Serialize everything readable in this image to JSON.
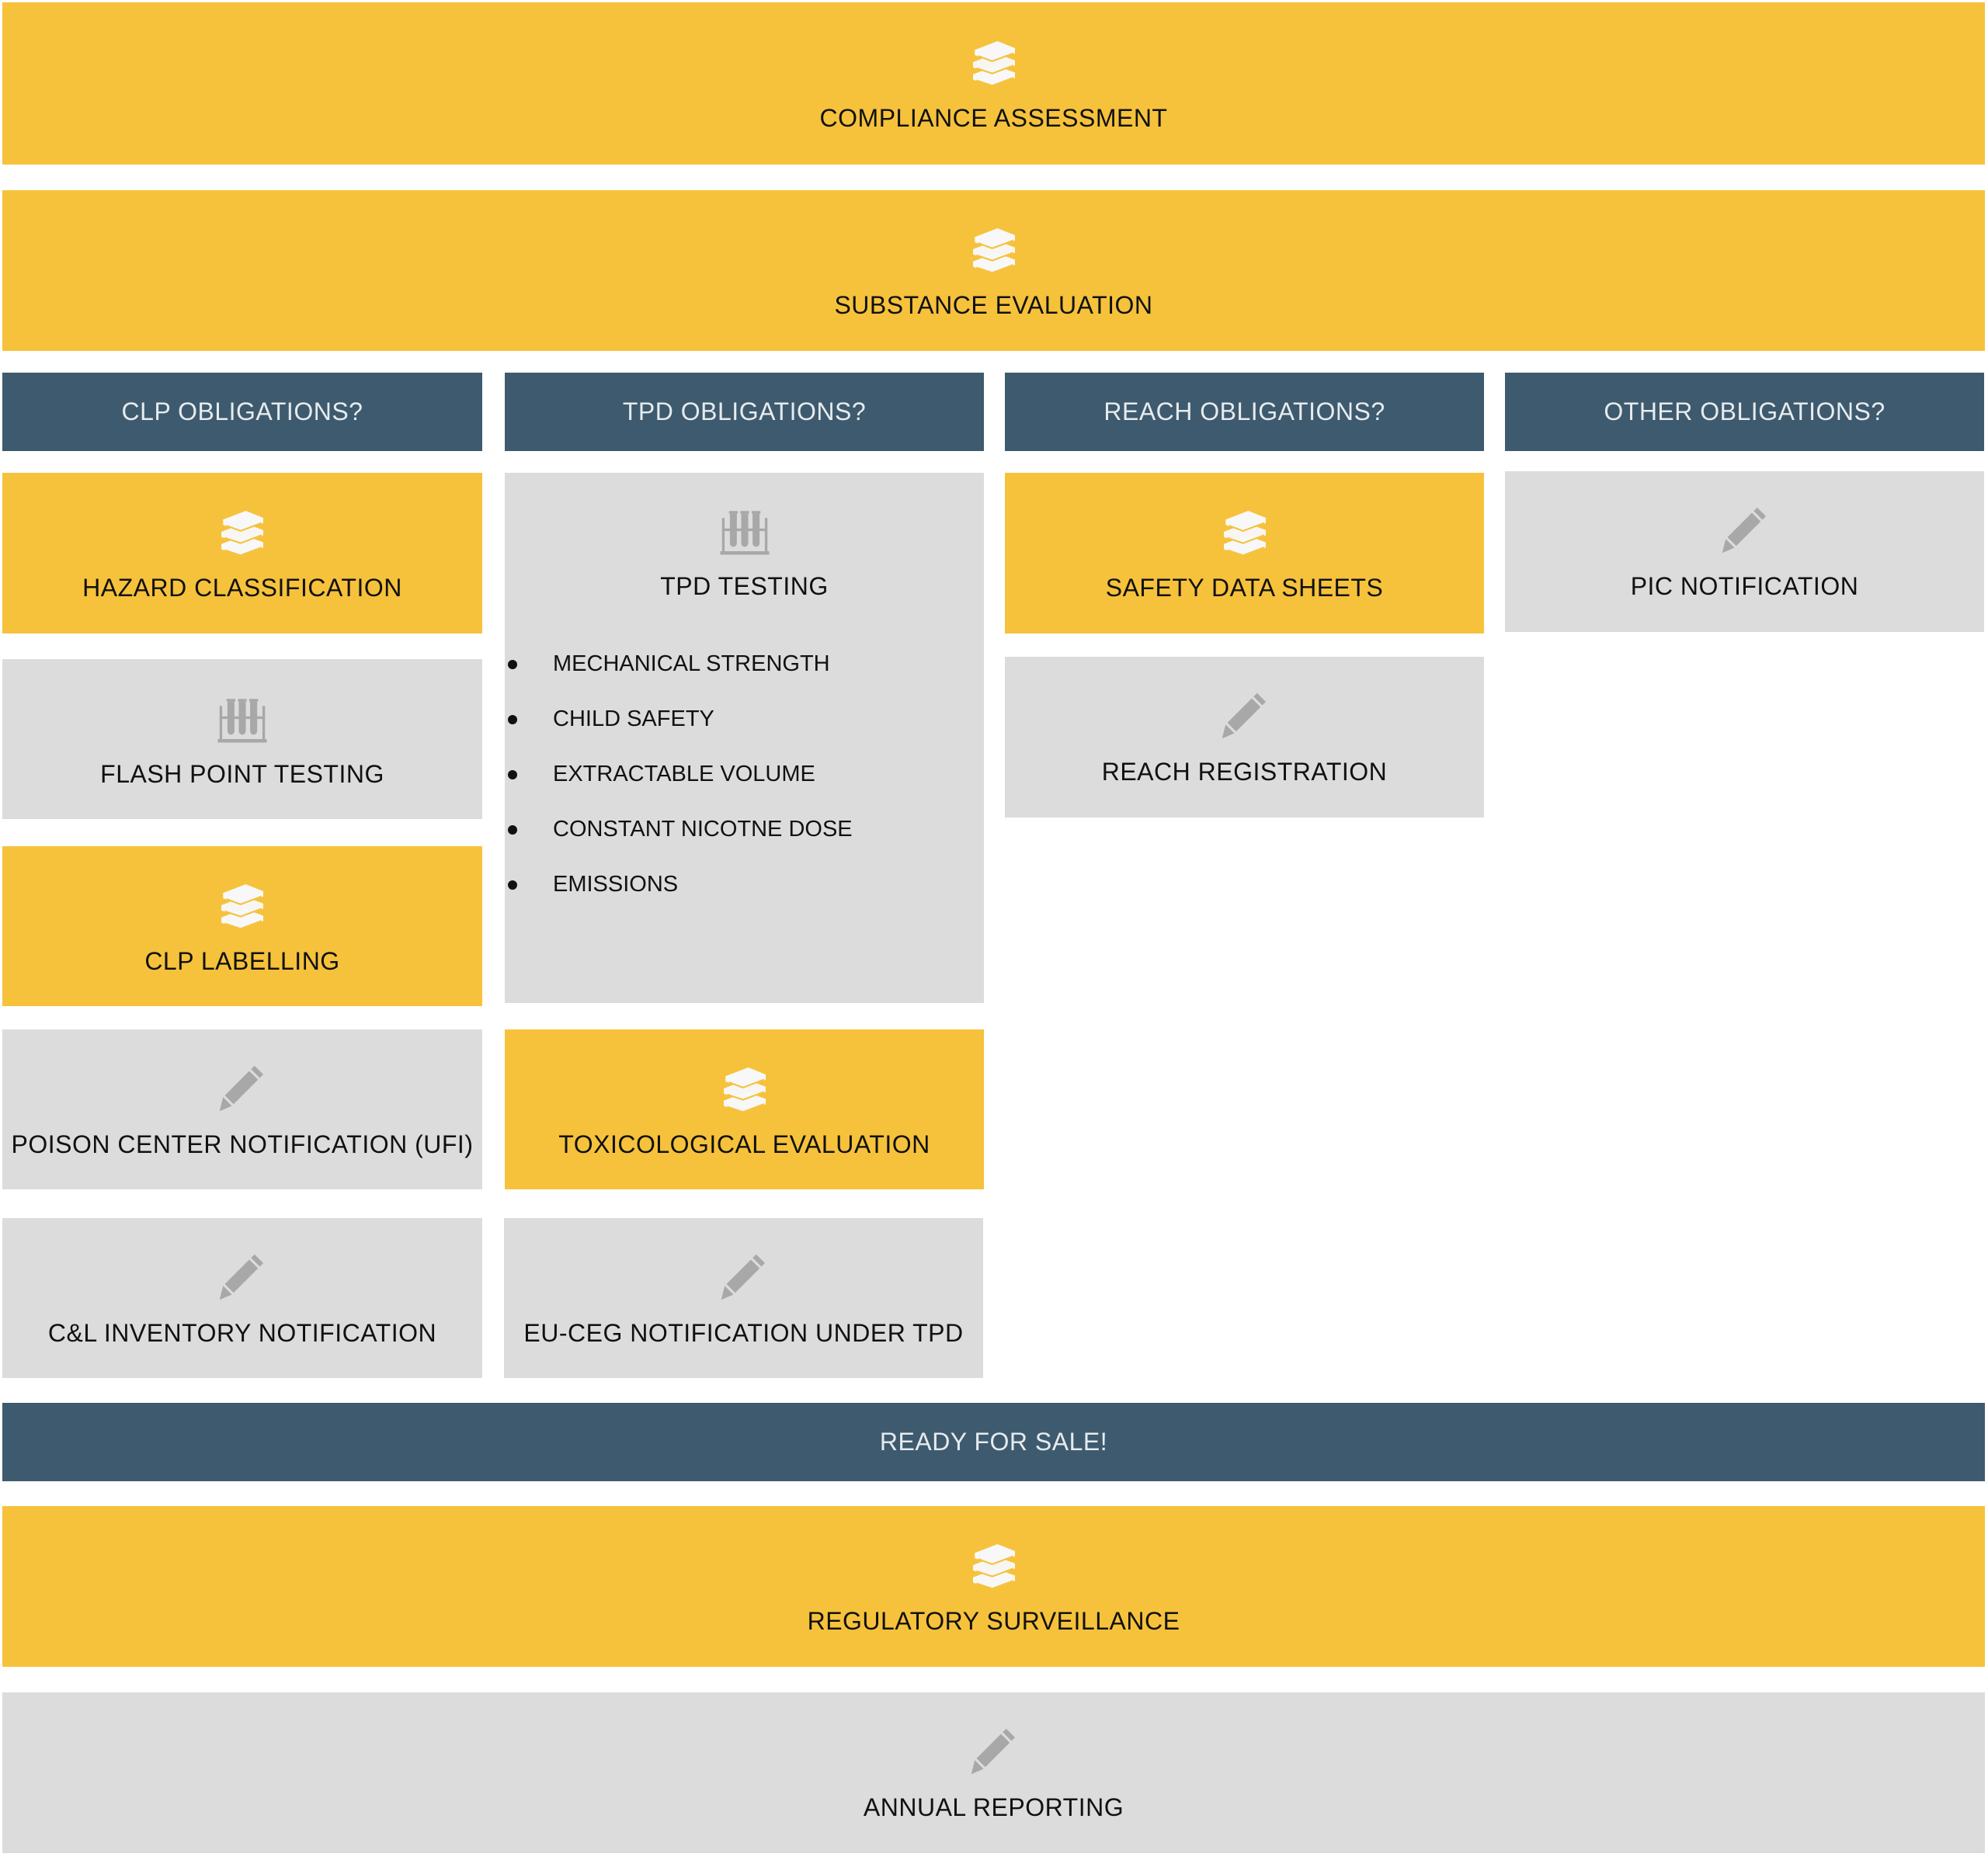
{
  "colors": {
    "yellow": "#f6c23c",
    "grey": "#dcdcdc",
    "navy": "#3e5a6e"
  },
  "top": [
    {
      "label": "COMPLIANCE ASSESSMENT",
      "icon": "books-icon"
    },
    {
      "label": "SUBSTANCE EVALUATION",
      "icon": "books-icon"
    }
  ],
  "columns": [
    {
      "header": "CLP OBLIGATIONS?"
    },
    {
      "header": "TPD OBLIGATIONS?"
    },
    {
      "header": "REACH OBLIGATIONS?"
    },
    {
      "header": "OTHER OBLIGATIONS?"
    }
  ],
  "clp": [
    {
      "label": "HAZARD CLASSIFICATION",
      "icon": "books-icon"
    },
    {
      "label": "FLASH POINT TESTING",
      "icon": "test-tubes-icon"
    },
    {
      "label": "CLP LABELLING",
      "icon": "books-icon"
    },
    {
      "label": "POISON CENTER NOTIFICATION (UFI)",
      "icon": "pencil-icon"
    },
    {
      "label": "C&L INVENTORY NOTIFICATION",
      "icon": "pencil-icon"
    }
  ],
  "tpd": {
    "testing": {
      "label": "TPD TESTING",
      "icon": "test-tubes-icon",
      "items": [
        "MECHANICAL STRENGTH",
        "CHILD SAFETY",
        "EXTRACTABLE VOLUME",
        "CONSTANT NICOTNE DOSE",
        "EMISSIONS"
      ]
    },
    "tox": {
      "label": "TOXICOLOGICAL EVALUATION",
      "icon": "books-icon"
    },
    "euceg": {
      "label": "EU-CEG NOTIFICATION UNDER TPD",
      "icon": "pencil-icon"
    }
  },
  "reach": [
    {
      "label": "SAFETY DATA SHEETS",
      "icon": "books-icon"
    },
    {
      "label": "REACH REGISTRATION",
      "icon": "pencil-icon"
    }
  ],
  "other": [
    {
      "label": "PIC NOTIFICATION",
      "icon": "pencil-icon"
    }
  ],
  "ready": {
    "label": "READY FOR SALE!"
  },
  "bottom": [
    {
      "label": "REGULATORY SURVEILLANCE",
      "icon": "books-icon"
    },
    {
      "label": "ANNUAL REPORTING",
      "icon": "pencil-icon"
    }
  ]
}
